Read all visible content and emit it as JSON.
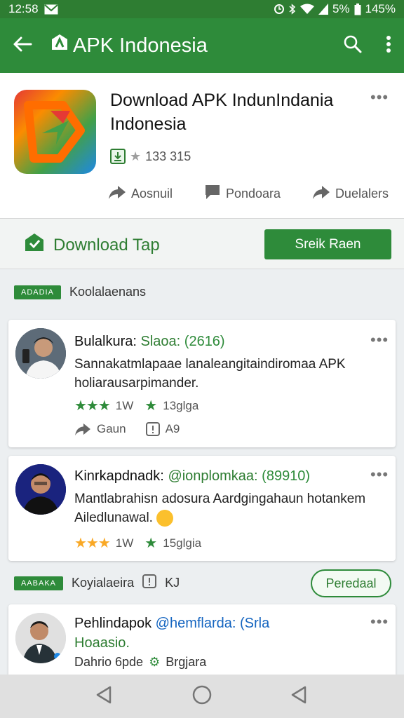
{
  "status_bar": {
    "time": "12:58",
    "battery_small": "5%",
    "battery": "145%"
  },
  "app_bar": {
    "title": "APK Indonesia"
  },
  "header": {
    "title_line1": "Download APK IndunIndania",
    "title_line2": "Indonesia",
    "rating": "133 315",
    "actions": [
      {
        "label": "Aosnuil",
        "icon": "share-icon"
      },
      {
        "label": "Pondoara",
        "icon": "comment-icon"
      },
      {
        "label": "Duelalers",
        "icon": "share-icon"
      }
    ]
  },
  "download_bar": {
    "tap_label": "Download Tap",
    "button_label": "Sreik Raen"
  },
  "section1": {
    "tag": "ADADIA",
    "label": "Koolalaenans"
  },
  "reviews": [
    {
      "name": "Bulalkura:",
      "handle": "Slaoa:",
      "count": "(2616)",
      "body": "Sannakatmlapaae lanaleangitaindiromaa APK holiarausarpimander.",
      "stars": "★★★",
      "likes": "1W",
      "votes": "13glga",
      "action1": "Gaun",
      "action2": "A9"
    },
    {
      "name": "Kinrkapdnadk:",
      "handle": "@ionplomkaa:",
      "count": "(89910)",
      "body": "Mantlabrahisn adosura Aardgingahaun hotankem Ailedlunawal.",
      "stars": "★★★",
      "likes": "1W",
      "votes": "15glgia"
    },
    {
      "name": "Pehlindapok",
      "handle": "@hemflarda: (Srla",
      "line2": "Hoaasio.",
      "line3": "Dahrio 6pde",
      "line3b": "Brgjara"
    }
  ],
  "section2": {
    "tag": "AABAKA",
    "label": "Koyialaeira",
    "extra": "KJ",
    "button": "Peredaal"
  },
  "colors": {
    "primary": "#2e8b3a",
    "status_bar": "#2e7d32",
    "star_gold": "#f9a825",
    "star_green": "#2e8b3a"
  }
}
